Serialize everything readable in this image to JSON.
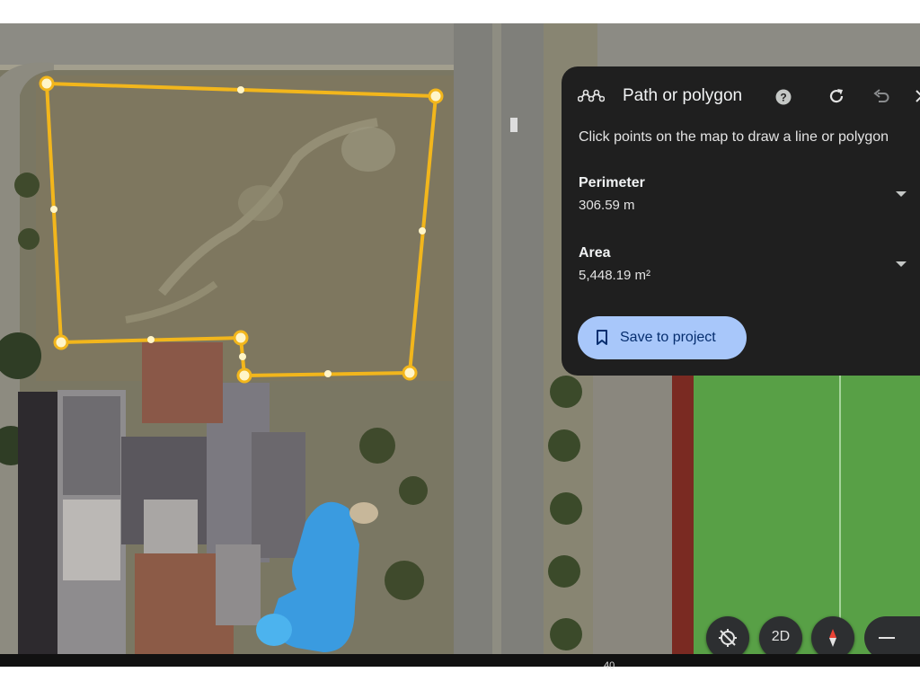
{
  "panel": {
    "title": "Path or polygon",
    "hint": "Click points on the map to draw a line or polygon",
    "perimeter_label": "Perimeter",
    "perimeter_value": "306.59 m",
    "area_label": "Area",
    "area_value": "5,448.19 m²",
    "save_label": "Save to project",
    "icons": [
      "path-polygon-icon",
      "help-icon",
      "redo-icon",
      "undo-icon",
      "close-icon",
      "chevron-down-icon",
      "bookmark-icon"
    ]
  },
  "controls": {
    "view_2d_label": "2D",
    "icons": [
      "location-disabled-icon",
      "compass-icon",
      "zoom-out-icon"
    ]
  },
  "bottom_text": "40",
  "colors": {
    "polygon": "#f2b61c",
    "panel_bg": "#1f1f1f",
    "button": "#a8c7fa",
    "field": "#58a046",
    "pool": "#3a9be0"
  }
}
